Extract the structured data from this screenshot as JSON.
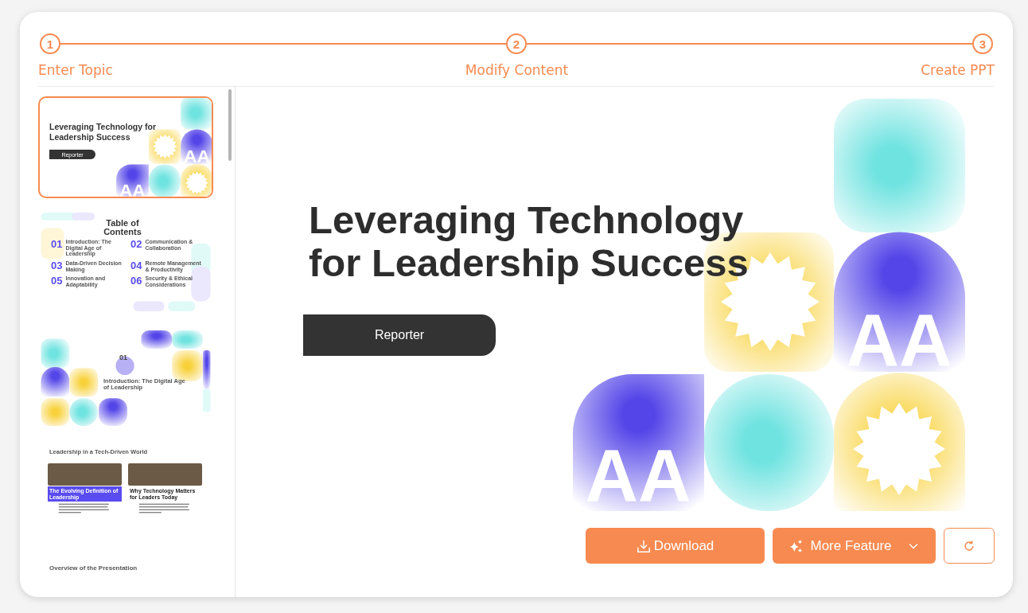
{
  "steps": [
    {
      "number": "1",
      "label": "Enter Topic"
    },
    {
      "number": "2",
      "label": "Modify Content"
    },
    {
      "number": "3",
      "label": "Create PPT"
    }
  ],
  "thumbnails": [
    {
      "kind": "title",
      "selected": true,
      "title": "Leveraging Technology for Leadership Success",
      "button": "Reporter",
      "marks": [
        "AA",
        "AA"
      ]
    },
    {
      "kind": "toc",
      "selected": false,
      "title": "Table of Contents",
      "items": [
        {
          "number": "01",
          "label": "Introduction: The Digital Age of Leadership"
        },
        {
          "number": "02",
          "label": "Communication & Collaboration"
        },
        {
          "number": "03",
          "label": "Data-Driven Decision Making"
        },
        {
          "number": "04",
          "label": "Remote Management & Productivity"
        },
        {
          "number": "05",
          "label": "Innovation and Adaptability"
        },
        {
          "number": "06",
          "label": "Security & Ethical Considerations"
        }
      ]
    },
    {
      "kind": "section",
      "selected": false,
      "number": "01",
      "title": "Introduction: The Digital Age of Leadership"
    },
    {
      "kind": "content",
      "selected": false,
      "title": "Leadership in a Tech-Driven World",
      "cards": [
        {
          "heading": "The Evolving Definition of Leadership",
          "highlighted": true
        },
        {
          "heading": "Why Technology Matters for Leaders Today",
          "highlighted": false
        }
      ]
    },
    {
      "kind": "heading",
      "selected": false,
      "title": "Overview of the Presentation"
    }
  ],
  "slide": {
    "title_lines": [
      "Leveraging Technology",
      "for Leadership Success"
    ],
    "button": "Reporter",
    "marks": [
      "AA",
      "AA"
    ]
  },
  "actions": {
    "download": "Download",
    "more": "More Feature"
  }
}
